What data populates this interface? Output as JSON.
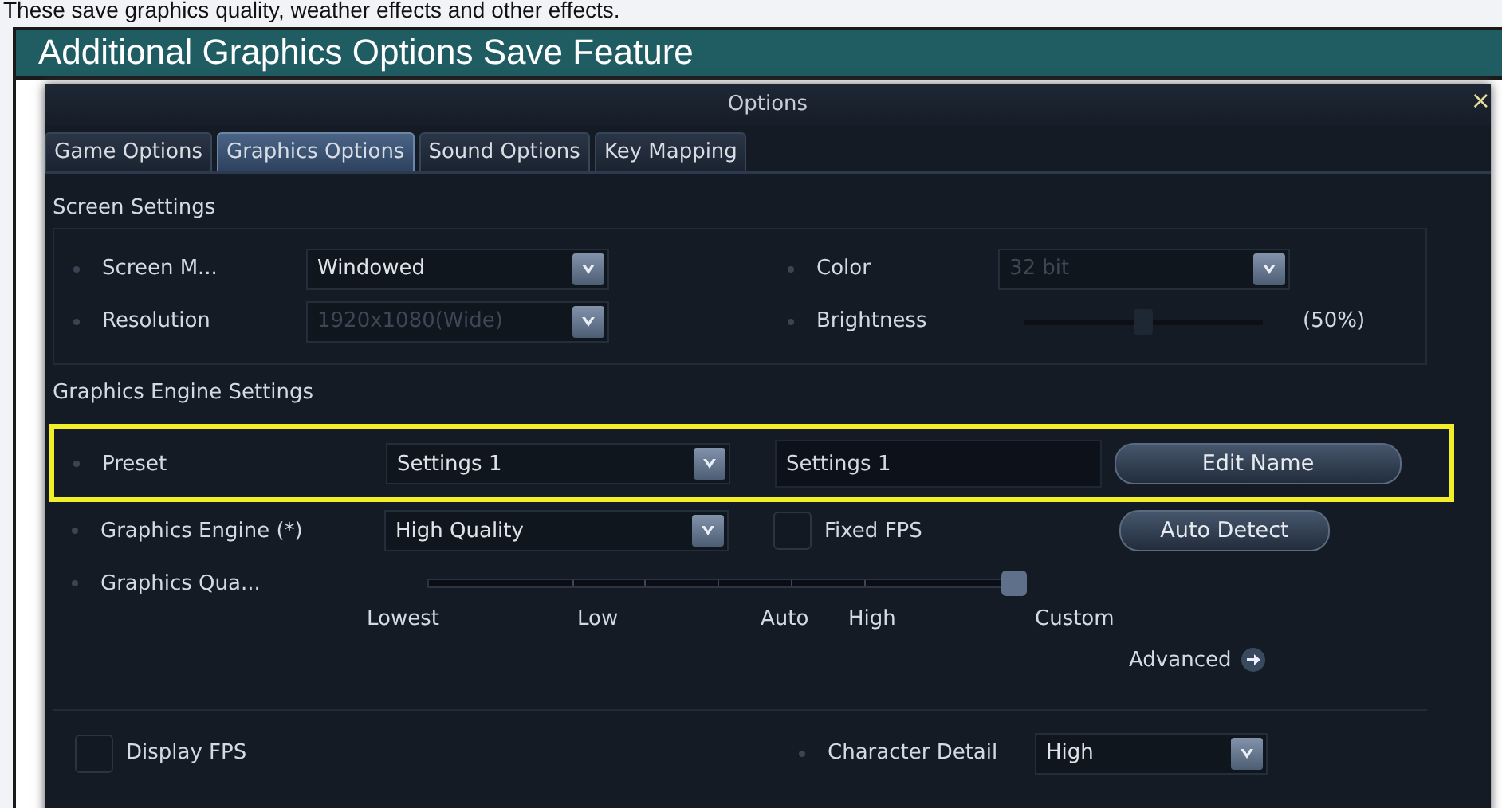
{
  "caption": "These save graphics quality, weather effects and other effects.",
  "header": {
    "title": "Additional Graphics Options Save Feature"
  },
  "window": {
    "title": "Options",
    "close": "×"
  },
  "tabs": [
    {
      "label": "Game Options",
      "selected": false
    },
    {
      "label": "Graphics Options",
      "selected": true
    },
    {
      "label": "Sound Options",
      "selected": false
    },
    {
      "label": "Key Mapping",
      "selected": false
    }
  ],
  "screen_settings": {
    "title": "Screen Settings",
    "screen_mode": {
      "label": "Screen M...",
      "value": "Windowed",
      "disabled": false
    },
    "resolution": {
      "label": "Resolution",
      "value": "1920x1080(Wide)",
      "disabled": true
    },
    "color": {
      "label": "Color",
      "value": "32 bit",
      "disabled": true
    },
    "brightness": {
      "label": "Brightness",
      "level": 0.5,
      "reading": "(50%)"
    }
  },
  "engine_settings": {
    "title": "Graphics Engine Settings",
    "preset": {
      "label": "Preset",
      "value": "Settings 1",
      "name_value": "Settings 1",
      "button": "Edit Name",
      "highlighted": true
    },
    "graphics_engine": {
      "label": "Graphics Engine (*)",
      "value": "High Quality",
      "disabled": false
    },
    "fixed_fps": {
      "label": "Fixed FPS",
      "checked": false
    },
    "auto_detect": "Auto Detect",
    "quality": {
      "label": "Graphics Qua...",
      "level": 1,
      "stops": [
        "Lowest",
        "Low",
        "Auto",
        "High",
        "Custom"
      ]
    },
    "advanced": "Advanced"
  },
  "display_fps": {
    "label": "Display FPS",
    "checked": false
  },
  "character_detail": {
    "label": "Character Detail",
    "value": "High",
    "disabled": false
  }
}
